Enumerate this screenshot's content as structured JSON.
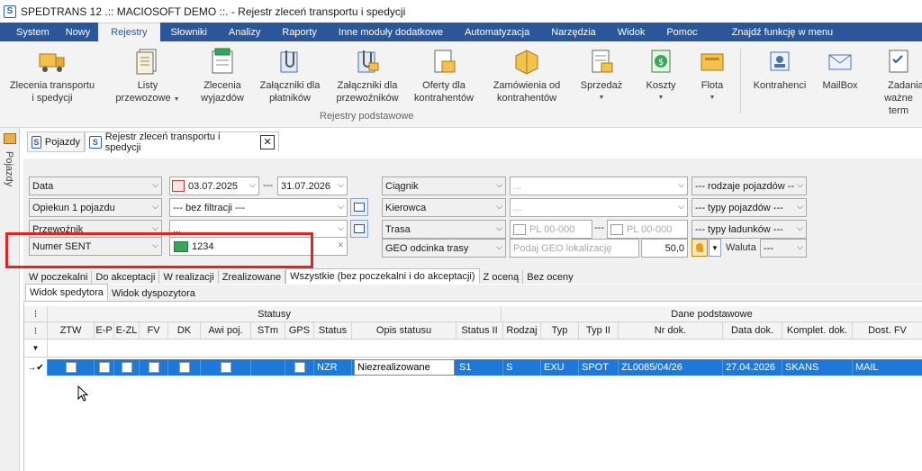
{
  "window": {
    "title": "SPEDTRANS 12 .:: MACIOSOFT DEMO ::. - Rejestr zleceń transportu i spedycji",
    "logo": "S"
  },
  "menu": {
    "items": [
      "System",
      "Nowy",
      "Rejestry",
      "Słowniki",
      "Analizy",
      "Raporty",
      "Inne moduły dodatkowe",
      "Automatyzacja",
      "Narzędzia",
      "Widok",
      "Pomoc"
    ],
    "active": "Rejestry",
    "search": "Znajdź funkcję w menu"
  },
  "ribbon": {
    "buttons": [
      {
        "l1": "Zlecenia transportu",
        "l2": "i spedycji",
        "icon": "truck-icon",
        "arrow": false
      },
      {
        "l1": "Listy",
        "l2": "przewozowe",
        "icon": "document-list-icon",
        "arrow": true
      },
      {
        "l1": "Zlecenia",
        "l2": "wyjazdów",
        "icon": "departure-orders-icon",
        "arrow": false
      },
      {
        "l1": "Załączniki dla",
        "l2": "płatników",
        "icon": "payer-attachments-icon",
        "arrow": false
      },
      {
        "l1": "Załączniki dla",
        "l2": "przewoźników",
        "icon": "carrier-attachments-icon",
        "arrow": false
      },
      {
        "l1": "Oferty dla",
        "l2": "kontrahentów",
        "icon": "offers-icon",
        "arrow": false
      },
      {
        "l1": "Zamówienia od",
        "l2": "kontrahentów",
        "icon": "customer-orders-icon",
        "arrow": false
      },
      {
        "l1": "Sprzedaż",
        "l2": "",
        "icon": "sales-icon",
        "arrow": true
      },
      {
        "l1": "Koszty",
        "l2": "",
        "icon": "costs-icon",
        "arrow": true
      },
      {
        "l1": "Flota",
        "l2": "",
        "icon": "fleet-icon",
        "arrow": true
      },
      {
        "l1": "Kontrahenci",
        "l2": "",
        "icon": "contractors-icon",
        "arrow": false
      },
      {
        "l1": "MailBox",
        "l2": "",
        "icon": "mailbox-icon",
        "arrow": false
      },
      {
        "l1": "Zadania",
        "l2": "ważne term",
        "icon": "tasks-icon",
        "arrow": false
      }
    ],
    "group_label": "Rejestry podstawowe"
  },
  "sidebar": {
    "label": "Pojazdy"
  },
  "tabs": [
    {
      "label": "Pojazdy",
      "active": false
    },
    {
      "label": "Rejestr zleceń transportu i spedycji",
      "active": true
    }
  ],
  "filters": {
    "date_field": "Data",
    "date_from": "03.07.2025",
    "date_sep": "---",
    "date_to": "31.07.2026",
    "guardian_field": "Opiekun 1 pojazdu",
    "guardian_value": "--- bez filtracji ---",
    "carrier_field": "Przewoźnik",
    "carrier_value": "...",
    "sent_field": "Numer SENT",
    "sent_value": "1234",
    "tractor_field": "Ciągnik",
    "tractor_value": "...",
    "driver_field": "Kierowca",
    "driver_value": "...",
    "route_field": "Trasa",
    "route_from_ph": "PL 00-000",
    "route_sep": "---",
    "route_to_ph": "PL 00-000",
    "geo_field": "GEO odcinka trasy",
    "geo_ph": "Podaj GEO lokalizację",
    "geo_value": "50,0",
    "currency_label": "Waluta",
    "currency_value": "---",
    "vehicle_kinds": "--- rodzaje pojazdów --",
    "vehicle_types": "--- typy pojazdów ---",
    "cargo_types": "--- typy ładunków ---"
  },
  "status_tabs": [
    "W poczekalni",
    "Do akceptacji",
    "W realizacji",
    "Zrealizowane",
    "Wszystkie (bez poczekalni i do akceptacji)",
    "Z oceną",
    "Bez oceny"
  ],
  "status_tab_active": 4,
  "view_tabs": [
    "Widok spedytora",
    "Widok dyspozytora"
  ],
  "grid": {
    "group_headers": {
      "statusy": "Statusy",
      "dane": "Dane podstawowe"
    },
    "columns": [
      "ZTW",
      "E-P",
      "E-ZL",
      "FV",
      "DK",
      "Awi poj.",
      "STm",
      "GPS",
      "Status",
      "Opis statusu",
      "Status II",
      "Rodzaj",
      "Typ",
      "Typ II",
      "Nr dok.",
      "Data dok.",
      "Komplet. dok.",
      "Dost. FV"
    ],
    "filter_symbol": "▼",
    "rows": [
      {
        "status": "NZR",
        "opis": "Niezrealizowane",
        "status2": "S1",
        "rodzaj": "S",
        "typ": "EXU",
        "typ2": "SPOT",
        "nr": "ZL0085/04/26",
        "data": "27.04.2026",
        "komplet": "SKANS",
        "dost": "MAIL"
      }
    ]
  }
}
